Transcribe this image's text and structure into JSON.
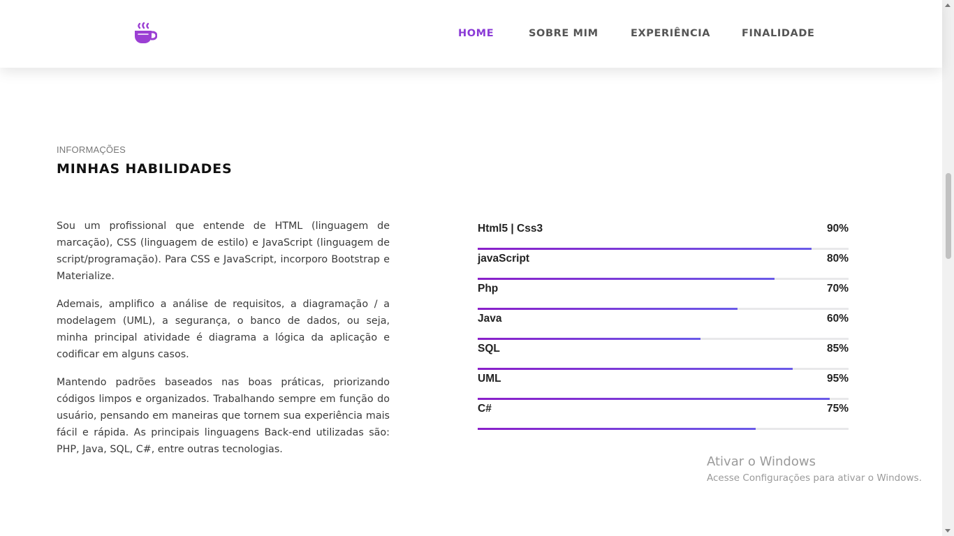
{
  "header": {
    "logo_icon": "coffee-cup-icon",
    "brand_color": "#9b3fd3",
    "nav": [
      {
        "label": "HOME",
        "active": true
      },
      {
        "label": "SOBRE MIM",
        "active": false
      },
      {
        "label": "EXPERIÊNCIA",
        "active": false
      },
      {
        "label": "FINALIDADE",
        "active": false
      }
    ]
  },
  "section": {
    "eyebrow": "INFORMAÇÕES",
    "title": "MINHAS HABILIDADES",
    "paragraphs": [
      "Sou um profissional que entende de HTML (linguagem de marcação), CSS (linguagem de estilo) e JavaScript (linguagem de script/programação). Para CSS e JavaScript, incorporo Bootstrap e Materialize.",
      "Ademais, amplifico a análise de requisitos, a diagramação / a modelagem (UML), a segurança, o banco de dados, ou seja, minha principal atividade é diagrama a lógica da aplicação e codificar em alguns casos.",
      "Mantendo padrões baseados nas boas práticas, priorizando códigos limpos e organizados. Trabalhando sempre em função do usuário, pensando em maneiras que tornem sua experiência mais fácil e rápida. As principais linguagens Back-end utilizadas são: PHP, Java, SQL, C#, entre outras tecnologias."
    ]
  },
  "skills": [
    {
      "name": "Html5 | Css3",
      "percent_label": "90%",
      "fill": 0.9
    },
    {
      "name": "javaScript",
      "percent_label": "80%",
      "fill": 0.8
    },
    {
      "name": "Php",
      "percent_label": "70%",
      "fill": 0.7
    },
    {
      "name": "Java",
      "percent_label": "60%",
      "fill": 0.6
    },
    {
      "name": "SQL",
      "percent_label": "85%",
      "fill": 0.85
    },
    {
      "name": "UML",
      "percent_label": "95%",
      "fill": 0.95
    },
    {
      "name": "C#",
      "percent_label": "75%",
      "fill": 0.75
    }
  ],
  "watermark": {
    "title": "Ativar o Windows",
    "subtitle": "Acesse Configurações para ativar o Windows."
  }
}
